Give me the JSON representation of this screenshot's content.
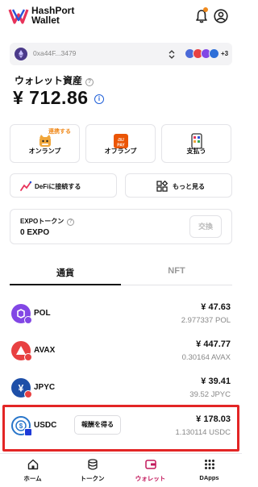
{
  "header": {
    "brand_line1": "HashPort",
    "brand_line2": "Wallet"
  },
  "address_bar": {
    "address": "0xa44F...3479",
    "more_chains": "+3"
  },
  "balance": {
    "label": "ウォレット資産",
    "amount": "¥ 712.86"
  },
  "actions": [
    {
      "label": "オンランプ",
      "tag": "連携する"
    },
    {
      "label": "オフランプ"
    },
    {
      "label": "支払う"
    }
  ],
  "wide_actions": [
    {
      "label": "DeFiに接続する"
    },
    {
      "label": "もっと見る"
    }
  ],
  "expo": {
    "title": "EXPOトークン",
    "value": "0 EXPO",
    "swap_label": "交換"
  },
  "tabs": [
    {
      "label": "通貨"
    },
    {
      "label": "NFT"
    }
  ],
  "tokens": [
    {
      "name": "POL",
      "fiat": "¥ 47.63",
      "amount": "2.977337 POL"
    },
    {
      "name": "AVAX",
      "fiat": "¥ 447.77",
      "amount": "0.30164 AVAX"
    },
    {
      "name": "JPYC",
      "fiat": "¥ 39.41",
      "amount": "39.52 JPYC"
    },
    {
      "name": "USDC",
      "fiat": "¥ 178.03",
      "amount": "1.130114 USDC",
      "reward_label": "報酬を得る"
    }
  ],
  "nav": [
    {
      "label": "ホーム"
    },
    {
      "label": "トークン"
    },
    {
      "label": "ウォレット"
    },
    {
      "label": "DApps"
    }
  ],
  "colors": {
    "accent_orange": "#f08a1c",
    "highlight_red": "#e32525",
    "info_blue": "#1f5fd8",
    "nav_active": "#c2185b"
  }
}
